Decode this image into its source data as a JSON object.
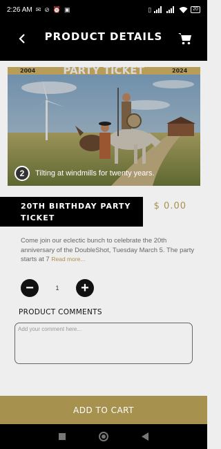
{
  "status_bar": {
    "time": "2:26 AM",
    "left_icons": [
      "notification-icon",
      "alarm-off-icon",
      "alarm-icon",
      "game-icon"
    ],
    "right_icons": [
      "vibrate-icon",
      "signal-icon",
      "signal-icon",
      "wifi-icon"
    ],
    "battery": "20"
  },
  "header": {
    "title": "PRODUCT DETAILS",
    "back_icon": "chevron-left-icon",
    "cart_icon": "cart-icon"
  },
  "image": {
    "banner_left": "2004",
    "banner_text": "PARTY TICKET",
    "banner_right": "2024",
    "badge": "2",
    "caption": "Tilting at windmills for twenty years."
  },
  "product": {
    "title": "20TH BIRTHDAY PARTY TICKET",
    "price": "$ 0.00",
    "description": "Come join our eclectic bunch to celebrate the 20th anniversary of the DoubleShot, Tuesday March 5. The party starts at 7",
    "read_more": "Read more..."
  },
  "quantity": {
    "value": "1",
    "minus": "−",
    "plus": "+"
  },
  "comments": {
    "label": "PRODUCT COMMENTS",
    "placeholder": "Add your comment here..."
  },
  "actions": {
    "add_to_cart": "ADD TO CART"
  },
  "nav": {
    "items": [
      "recents-icon",
      "home-icon",
      "back-icon"
    ]
  },
  "colors": {
    "accent": "#a7914f",
    "header_bg": "#000000",
    "page_bg": "#eeeeee"
  }
}
